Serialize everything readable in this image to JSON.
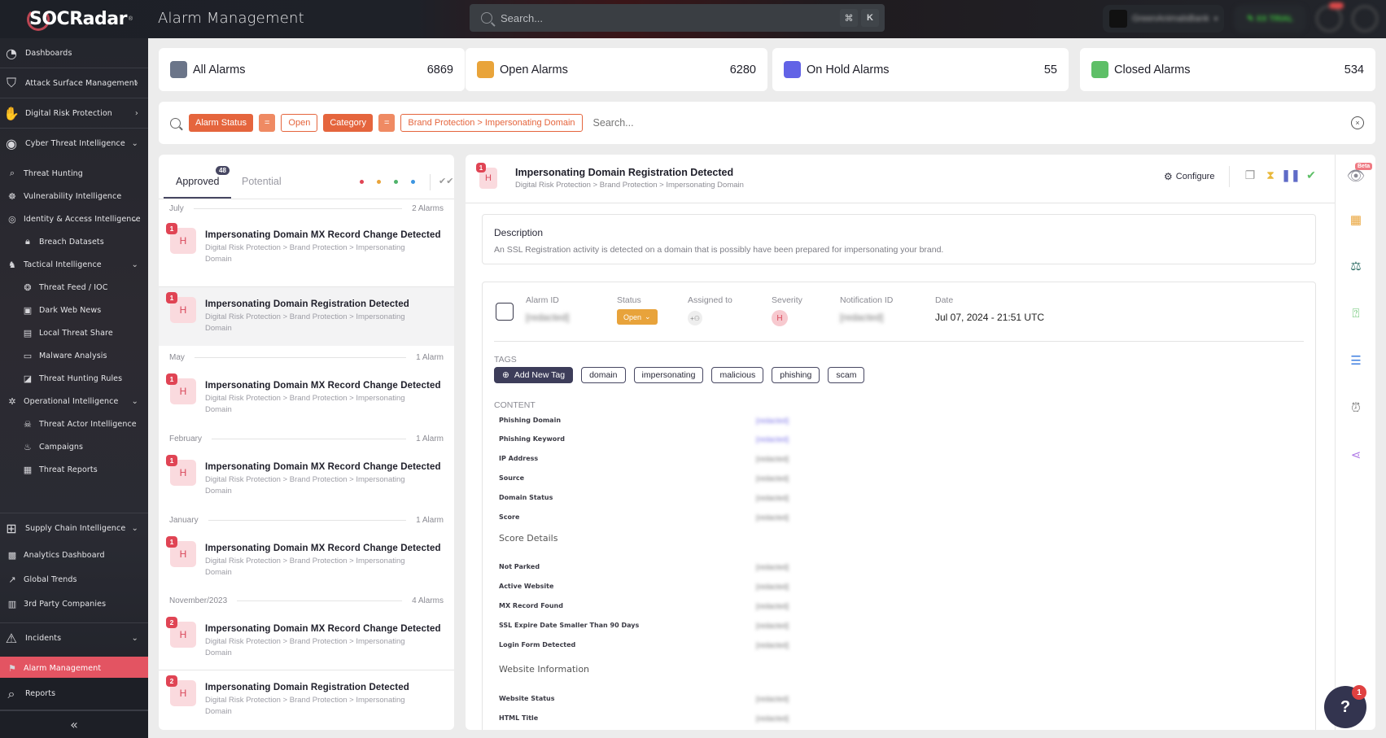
{
  "header": {
    "logo": "SOCRadar",
    "logo_mark": "®",
    "page_title": "Alarm Management",
    "search_placeholder": "Search...",
    "shortcut_cmd": "⌘",
    "shortcut_key": "K",
    "org_name": "GreenAnimalsBank",
    "trial_label": "XX TRIAL"
  },
  "sidebar": {
    "items": [
      {
        "label": "Dashboards",
        "icon": "dashboard-icon"
      },
      {
        "label": "Attack Surface Management",
        "icon": "shield-scan-icon"
      },
      {
        "label": "Digital Risk Protection",
        "icon": "hand-icon"
      },
      {
        "label": "Cyber Threat Intelligence",
        "icon": "eye-shield-icon"
      },
      {
        "label": "Threat Hunting",
        "icon": "search-icon"
      },
      {
        "label": "Vulnerability Intelligence",
        "icon": "bug-icon"
      },
      {
        "label": "Identity & Access Intelligence",
        "icon": "fingerprint-icon"
      },
      {
        "label": "Breach Datasets",
        "icon": "lock-icon"
      },
      {
        "label": "Tactical Intelligence",
        "icon": "chess-knight-icon"
      },
      {
        "label": "Threat Feed / IOC",
        "icon": "feed-icon"
      },
      {
        "label": "Dark Web News",
        "icon": "dark-web-icon"
      },
      {
        "label": "Local Threat Share",
        "icon": "share-card-icon"
      },
      {
        "label": "Malware Analysis",
        "icon": "monitor-icon"
      },
      {
        "label": "Threat Hunting Rules",
        "icon": "rules-icon"
      },
      {
        "label": "Operational Intelligence",
        "icon": "virus-icon"
      },
      {
        "label": "Threat Actor Intelligence",
        "icon": "hacker-icon"
      },
      {
        "label": "Campaigns",
        "icon": "fire-icon"
      },
      {
        "label": "Threat Reports",
        "icon": "report-icon"
      },
      {
        "label": "Supply Chain Intelligence",
        "icon": "network-icon"
      },
      {
        "label": "Analytics Dashboard",
        "icon": "analytics-icon"
      },
      {
        "label": "Global Trends",
        "icon": "trend-icon"
      },
      {
        "label": "3rd Party Companies",
        "icon": "building-icon"
      },
      {
        "label": "Incidents",
        "icon": "alert-monitor-icon"
      },
      {
        "label": "Alarm Management",
        "icon": "siren-icon"
      },
      {
        "label": "Reports",
        "icon": "report-search-icon"
      }
    ],
    "collapse_label": "«"
  },
  "cards": [
    {
      "label": "All Alarms",
      "count": "6869",
      "color": "#6b7589"
    },
    {
      "label": "Open Alarms",
      "count": "6280",
      "color": "#e9a43a"
    },
    {
      "label": "On Hold Alarms",
      "count": "55",
      "color": "#6263e6"
    },
    {
      "label": "Closed Alarms",
      "count": "534",
      "color": "#5ebf67"
    }
  ],
  "filter": {
    "chips": [
      {
        "key": "Alarm Status",
        "op": "=",
        "value": "Open"
      },
      {
        "key": "Category",
        "op": "=",
        "value": "Brand Protection > Impersonating Domain"
      }
    ],
    "placeholder": "Search...",
    "clear_label": "×"
  },
  "list": {
    "tabs": [
      {
        "label": "Approved",
        "badge": "48",
        "active": true
      },
      {
        "label": "Potential",
        "active": false
      }
    ],
    "severity_dots": [
      "#e04454",
      "#e9a43a",
      "#4fb36a",
      "#3d95e0"
    ],
    "groups": [
      {
        "month": "July",
        "count": "2 Alarms",
        "items": [
          {
            "count": "1",
            "severity": "H",
            "title": "Impersonating Domain MX Record Change Detected",
            "path": "Digital Risk Protection > Brand Protection > Impersonating Domain"
          },
          {
            "count": "1",
            "severity": "H",
            "title": "Impersonating Domain Registration Detected",
            "path": "Digital Risk Protection > Brand Protection > Impersonating Domain",
            "selected": true
          }
        ]
      },
      {
        "month": "May",
        "count": "1 Alarm",
        "items": [
          {
            "count": "1",
            "severity": "H",
            "title": "Impersonating Domain MX Record Change Detected",
            "path": "Digital Risk Protection > Brand Protection > Impersonating Domain"
          }
        ]
      },
      {
        "month": "February",
        "count": "1 Alarm",
        "items": [
          {
            "count": "1",
            "severity": "H",
            "title": "Impersonating Domain MX Record Change Detected",
            "path": "Digital Risk Protection > Brand Protection > Impersonating Domain"
          }
        ]
      },
      {
        "month": "January",
        "count": "1 Alarm",
        "items": [
          {
            "count": "1",
            "severity": "H",
            "title": "Impersonating Domain MX Record Change Detected",
            "path": "Digital Risk Protection > Brand Protection > Impersonating Domain"
          }
        ]
      },
      {
        "month": "November/2023",
        "count": "4 Alarms",
        "items": [
          {
            "count": "2",
            "severity": "H",
            "title": "Impersonating Domain MX Record Change Detected",
            "path": "Digital Risk Protection > Brand Protection > Impersonating Domain"
          },
          {
            "count": "2",
            "severity": "H",
            "title": "Impersonating Domain Registration Detected",
            "path": "Digital Risk Protection > Brand Protection > Impersonating Domain"
          }
        ]
      }
    ]
  },
  "detail": {
    "count": "1",
    "severity": "H",
    "title": "Impersonating Domain Registration Detected",
    "path": "Digital Risk Protection > Brand Protection > Impersonating Domain",
    "configure_label": "Configure",
    "description_title": "Description",
    "description": "An SSL Registration activity is detected on a domain that is possibly have been prepared for impersonating your brand.",
    "meta": {
      "alarm_id_label": "Alarm ID",
      "alarm_id": "[redacted]",
      "status_label": "Status",
      "status": "Open",
      "assigned_label": "Assigned to",
      "severity_label": "Severity",
      "severity": "H",
      "notification_id_label": "Notification ID",
      "notification_id": "[redacted]",
      "date_label": "Date",
      "date": "Jul 07, 2024 - 21:51 UTC"
    },
    "tags_label": "TAGS",
    "add_tag_label": "Add New Tag",
    "tags": [
      "domain",
      "impersonating",
      "malicious",
      "phishing",
      "scam"
    ],
    "content_label": "CONTENT",
    "content": [
      {
        "key": "Phishing Domain",
        "value": "[redacted]",
        "link": true
      },
      {
        "key": "Phishing Keyword",
        "value": "[redacted]",
        "link": true
      },
      {
        "key": "IP Address",
        "value": "[redacted]"
      },
      {
        "key": "Source",
        "value": "[redacted]"
      },
      {
        "key": "Domain Status",
        "value": "[redacted]"
      },
      {
        "key": "Score",
        "value": "[redacted]"
      }
    ],
    "score_details_label": "Score Details",
    "score_details": [
      {
        "key": "Not Parked",
        "value": "[redacted]"
      },
      {
        "key": "Active Website",
        "value": "[redacted]"
      },
      {
        "key": "MX Record Found",
        "value": "[redacted]"
      },
      {
        "key": "SSL Expire Date Smaller Than 90 Days",
        "value": "[redacted]"
      },
      {
        "key": "Login Form Detected",
        "value": "[redacted]"
      }
    ],
    "website_info_label": "Website Information",
    "website_info": [
      {
        "key": "Website Status",
        "value": "[redacted]"
      },
      {
        "key": "HTML Title",
        "value": "[redacted]"
      }
    ]
  },
  "rail": {
    "beta_label": "Beta"
  },
  "help": {
    "badge": "1"
  }
}
